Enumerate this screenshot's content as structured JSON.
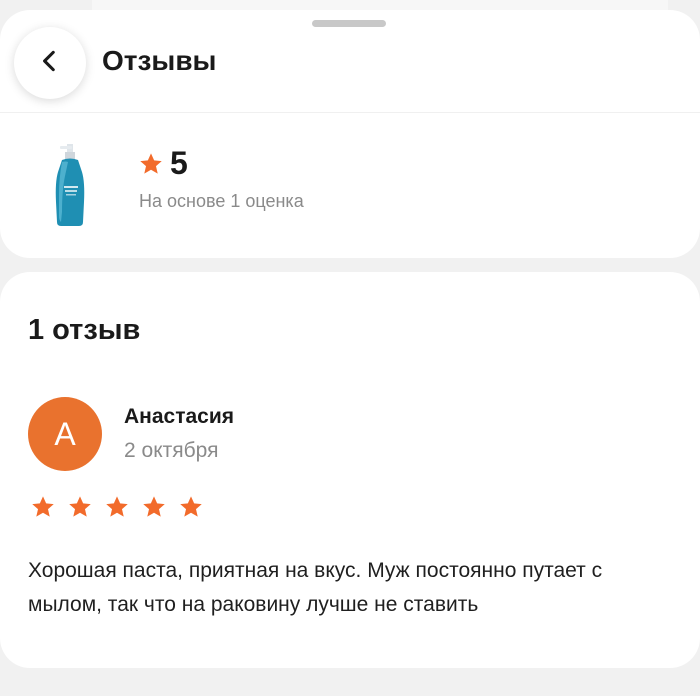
{
  "header": {
    "title": "Отзывы",
    "back_icon": "chevron-left-icon"
  },
  "product": {
    "image": "product-bottle-image",
    "rating_value": "5",
    "rating_icon": "star-icon",
    "rating_basis": "На основе 1 оценка"
  },
  "reviews": {
    "count_label": "1 отзыв",
    "items": [
      {
        "avatar_letter": "А",
        "author": "Анастасия",
        "date": "2 октября",
        "stars": 5,
        "text": "Хорошая паста, приятная на вкус. Муж постоянно путает с мылом, так что на раковину лучше не ставить"
      }
    ]
  },
  "colors": {
    "accent": "#e9722e",
    "star": "#f26b2b",
    "background": "#f1f1f1",
    "card": "#ffffff",
    "secondary_text": "#8a8a8a"
  }
}
